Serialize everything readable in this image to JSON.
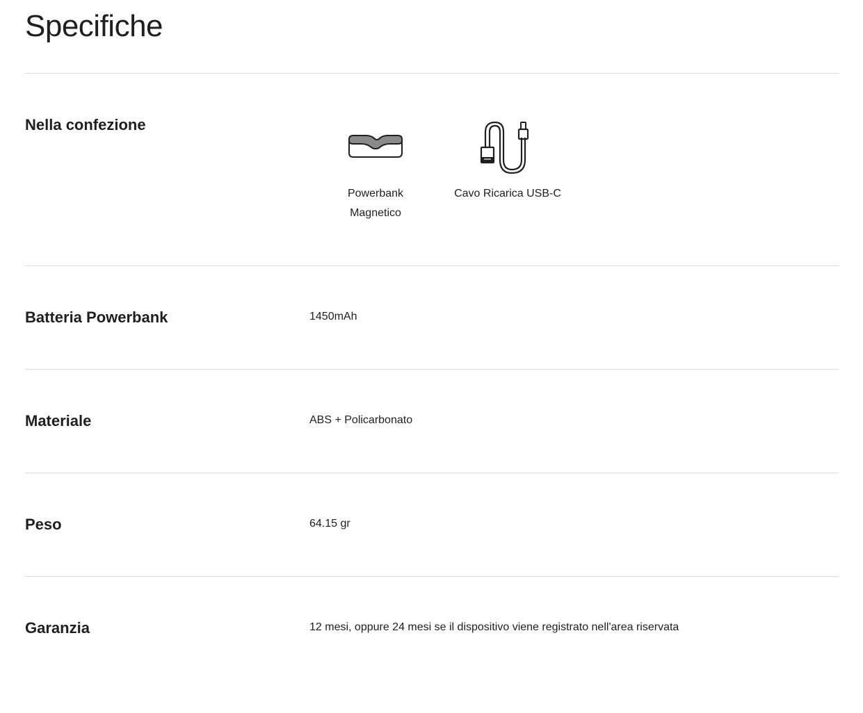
{
  "page": {
    "title": "Specifiche"
  },
  "specs": {
    "in_box": {
      "label": "Nella confezione",
      "items": [
        {
          "icon": "powerbank-icon",
          "label": "Powerbank Magnetico"
        },
        {
          "icon": "usb-c-cable-icon",
          "label": "Cavo Ricarica USB-C"
        }
      ]
    },
    "battery": {
      "label": "Batteria Powerbank",
      "value": "1450mAh"
    },
    "material": {
      "label": "Materiale",
      "value": "ABS + Policarbonato"
    },
    "weight": {
      "label": "Peso",
      "value": "64.15 gr"
    },
    "warranty": {
      "label": "Garanzia",
      "value": "12 mesi, oppure 24 mesi se il dispositivo viene registrato nell'area riservata"
    }
  }
}
